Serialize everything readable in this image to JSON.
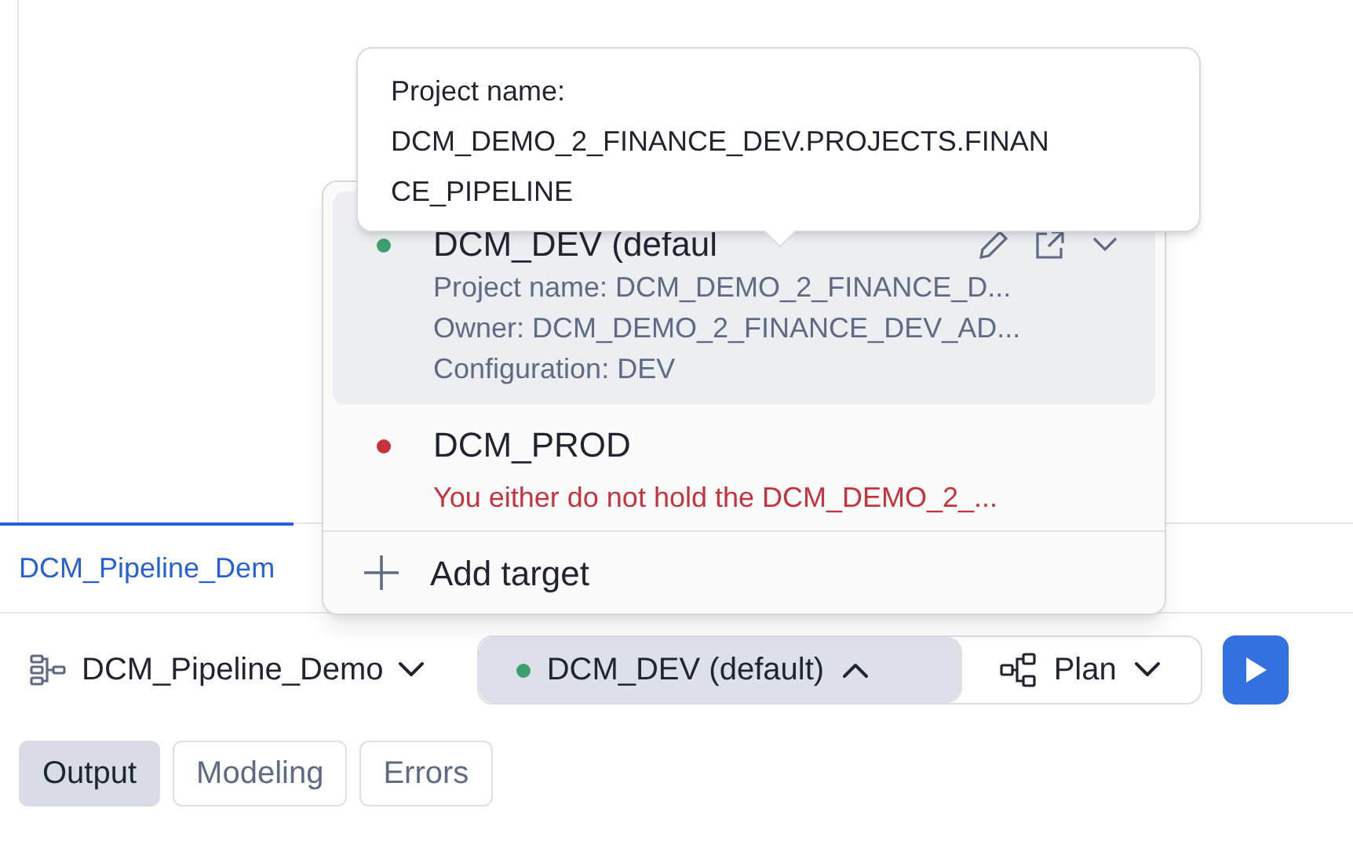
{
  "editor_tab": {
    "label": "DCM_Pipeline_Dem",
    "selected": true
  },
  "toolbar": {
    "project": "DCM_Pipeline_Demo",
    "target": {
      "label": "DCM_DEV (default)",
      "color": "#3f9e6e",
      "expanded": true
    },
    "action": "Plan"
  },
  "output_tabs": [
    {
      "label": "Output",
      "selected": true
    },
    {
      "label": "Modeling",
      "selected": false
    },
    {
      "label": "Errors",
      "selected": false
    }
  ],
  "target_menu": {
    "items": [
      {
        "kind": "target",
        "name": "DCM_DEV (defaul",
        "color": "#3f9e6e",
        "selected": true,
        "details": [
          "Project name: DCM_DEMO_2_FINANCE_D...",
          "Owner: DCM_DEMO_2_FINANCE_DEV_AD...",
          "Configuration: DEV"
        ]
      },
      {
        "kind": "error",
        "name": "DCM_PROD",
        "color": "#c8323a",
        "selected": false,
        "message": "You either do not hold the DCM_DEMO_2_..."
      }
    ],
    "add_label": "Add target"
  },
  "tooltip": {
    "lines": [
      "Project name:",
      "DCM_DEMO_2_FINANCE_DEV.PROJECTS.FINAN",
      "CE_PIPELINE"
    ]
  }
}
